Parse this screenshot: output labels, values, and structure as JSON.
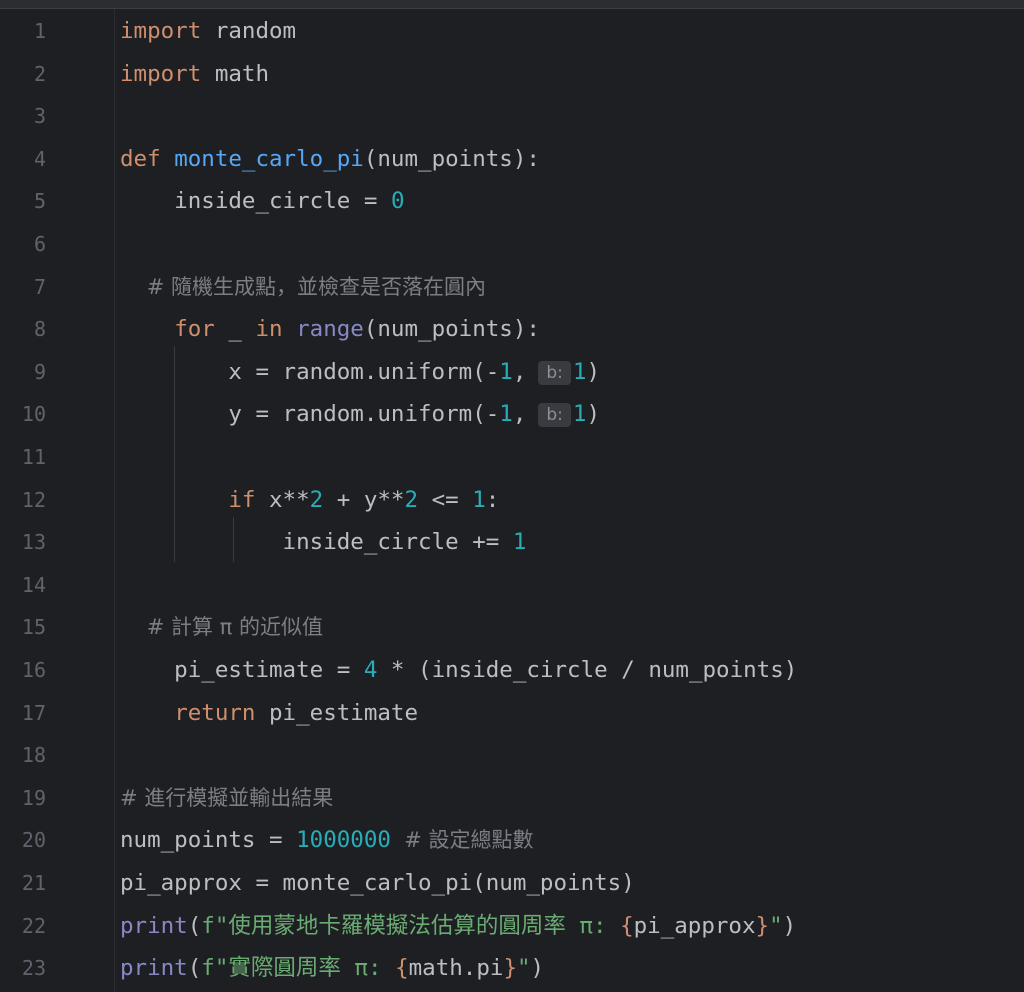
{
  "editor": {
    "line_numbers": [
      "1",
      "2",
      "3",
      "4",
      "5",
      "6",
      "7",
      "8",
      "9",
      "10",
      "11",
      "12",
      "13",
      "14",
      "15",
      "16",
      "17",
      "18",
      "19",
      "20",
      "21",
      "22",
      "23"
    ],
    "tokens": {
      "l1_import": "import",
      "l1_mod": " random",
      "l2_import": "import",
      "l2_mod": " math",
      "l4_def": "def",
      "l4_name": "monte_carlo_pi",
      "l4_sig": "(num_points):",
      "l5_var": "    inside_circle = ",
      "l5_num": "0",
      "l7_comment": "    # 隨機生成點，並檢查是否落在圓內",
      "l8_indent": "    ",
      "l8_for": "for",
      "l8_us": " _ ",
      "l8_in": "in",
      "l8_sp": " ",
      "l8_range": "range",
      "l8_args": "(num_points):",
      "l9_pre": "        x = random.uniform(-",
      "l9_n1": "1",
      "l9_comma": ",",
      "l9_hint": "b:",
      "l9_n2": "1",
      "l9_close": ")",
      "l10_pre": "        y = random.uniform(-",
      "l10_n1": "1",
      "l10_comma": ",",
      "l10_hint": "b:",
      "l10_n2": "1",
      "l10_close": ")",
      "l12_indent": "        ",
      "l12_if": "if",
      "l12_a": " x**",
      "l12_n1": "2",
      "l12_b": " + y**",
      "l12_n2": "2",
      "l12_c": " <= ",
      "l12_n3": "1",
      "l12_d": ":",
      "l13_pre": "            inside_circle += ",
      "l13_num": "1",
      "l15_comment": "    # 計算 π 的近似值",
      "l16_pre": "    pi_estimate = ",
      "l16_num": "4",
      "l16_post": " * (inside_circle / num_points)",
      "l17_indent": "    ",
      "l17_return": "return",
      "l17_post": " pi_estimate",
      "l19_comment": "# 進行模擬並輸出結果",
      "l20_pre": "num_points = ",
      "l20_num": "1000000",
      "l20_comment": "  # 設定總點數",
      "l21_code": "pi_approx = monte_carlo_pi(num_points)",
      "l22_print": "print",
      "l22_open": "(",
      "l22_str": "f\"使用蒙地卡羅模擬法估算的圓周率 π: ",
      "l22_lb": "{",
      "l22_expr": "pi_approx",
      "l22_rb": "}",
      "l22_strend": "\"",
      "l22_close": ")",
      "l23_print": "print",
      "l23_open": "(",
      "l23_str": "f\"實際圓周率 π: ",
      "l23_lb": "{",
      "l23_expr": "math.pi",
      "l23_rb": "}",
      "l23_strend": "\"",
      "l23_close": ")"
    }
  },
  "colors": {
    "background": "#1e1f22",
    "keyword": "#cf8e6d",
    "function_name": "#56a8f5",
    "number": "#2aacb8",
    "comment": "#7a7e85",
    "string": "#6aab73",
    "builtin": "#8888c6",
    "text": "#bcbec4",
    "line_number": "#5f636b"
  }
}
